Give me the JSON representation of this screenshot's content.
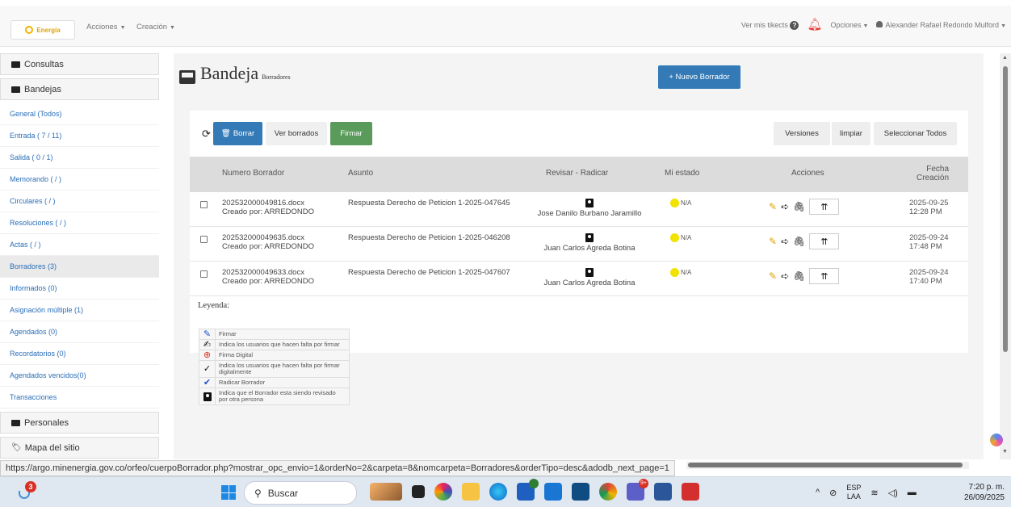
{
  "header": {
    "logo_text": "Energía",
    "menu": [
      "Acciones",
      "Creación"
    ],
    "tickets_label": "Ver mis tikects",
    "options_label": "Opciones",
    "user_name": "Alexander Rafael Redondo Mulford"
  },
  "sidebar": {
    "sections": [
      "Consultas",
      "Bandejas",
      "Personales",
      "Mapa del sitio"
    ],
    "items": [
      {
        "label": "General (Todos)"
      },
      {
        "label": "Entrada ( 7 / 11)"
      },
      {
        "label": "Salida ( 0 / 1)"
      },
      {
        "label": "Memorando ( / )"
      },
      {
        "label": "Circulares ( / )"
      },
      {
        "label": "Resoluciones ( / )"
      },
      {
        "label": "Actas ( / )"
      },
      {
        "label": "Borradores (3)"
      },
      {
        "label": "Informados (0)"
      },
      {
        "label": "Asignación múltiple (1)"
      },
      {
        "label": "Agendados (0)"
      },
      {
        "label": "Recordatorios (0)"
      },
      {
        "label": "Agendados vencidos(0)"
      },
      {
        "label": "Transacciones"
      }
    ],
    "active_item": "Borradores (3)"
  },
  "main": {
    "title": "Bandeja",
    "subtitle": "Borradores",
    "new_button": "+ Nuevo Borrador",
    "toolbar": {
      "delete_label": "Borrar",
      "view_deleted_label": "Ver borrados",
      "sign_label": "Firmar",
      "versions_label": "Versiones",
      "clear_label": "limpiar",
      "select_all_label": "Seleccionar Todos"
    },
    "columns": [
      "Numero Borrador",
      "Asunto",
      "Revisar - Radicar",
      "Mi estado",
      "Acciones",
      "Fecha",
      "Creación"
    ],
    "rows": [
      {
        "numero": "202532000049816.docx",
        "creado": "Creado por: ARREDONDO",
        "asunto": "Respuesta Derecho de Peticion 1-2025-047645",
        "revisor": "Jose Danilo Burbano Jaramillo",
        "estado": "N/A",
        "fecha": "2025-09-25",
        "hora": "12:28 PM"
      },
      {
        "numero": "202532000049635.docx",
        "creado": "Creado por: ARREDONDO",
        "asunto": "Respuesta Derecho de Peticion 1-2025-046208",
        "revisor": "Juan Carlos Agreda Botina",
        "estado": "N/A",
        "fecha": "2025-09-24",
        "hora": "17:48 PM"
      },
      {
        "numero": "202532000049633.docx",
        "creado": "Creado por: ARREDONDO",
        "asunto": "Respuesta Derecho de Peticion 1-2025-047607",
        "revisor": "Juan Carlos Agreda Botina",
        "estado": "N/A",
        "fecha": "2025-09-24",
        "hora": "17:40 PM"
      }
    ],
    "legend_title": "Leyenda:",
    "legend": [
      {
        "icon": "pencil-icon",
        "text": "Firmar"
      },
      {
        "icon": "pen-icon",
        "text": "Indica los usuarios que hacen falta por firmar"
      },
      {
        "icon": "digital-sign-icon",
        "text": "Firma Digital"
      },
      {
        "icon": "check-circle-icon",
        "text": "Indica los usuarios que hacen falta por firmar digitalmente"
      },
      {
        "icon": "double-check-icon",
        "text": "Radicar Borrador"
      },
      {
        "icon": "badge-icon",
        "text": "Indica que el Borrador esta siendo revisado por otra persona"
      }
    ]
  },
  "status_url": "https://argo.minenergia.gov.co/orfeo/cuerpoBorrador.php?mostrar_opc_envio=1&orderNo=2&carpeta=8&nomcarpeta=Borradores&orderTipo=desc&adodb_next_page=1",
  "taskbar": {
    "weather_badge": "3",
    "search_placeholder": "Buscar",
    "lang_top": "ESP",
    "lang_bottom": "LAA",
    "time": "7:20 p. m.",
    "date": "26/09/2025",
    "badges": [
      "9+"
    ]
  }
}
